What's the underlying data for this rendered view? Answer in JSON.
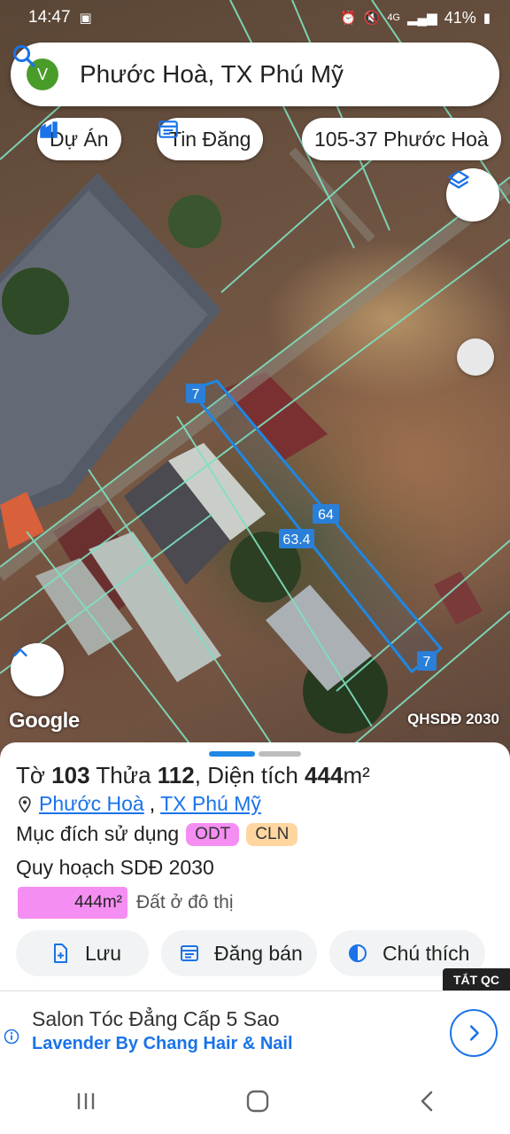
{
  "status_bar": {
    "time": "14:47",
    "battery": "41%",
    "network": "4G"
  },
  "search": {
    "avatar_letter": "V",
    "query": "Phước Hoà, TX Phú Mỹ"
  },
  "chips": [
    {
      "label": "Dự Án",
      "icon": "building-icon"
    },
    {
      "label": "Tin Đăng",
      "icon": "calendar-list-icon"
    },
    {
      "label": "105-37 Phước Hoà"
    }
  ],
  "map": {
    "parcel_labels": {
      "top": "7",
      "side_long": "64",
      "side_short": "63.4",
      "bottom": "7"
    },
    "google_logo": "Google",
    "plan_tag": "QHSDĐ 2030",
    "accent_color": "#1e88e5",
    "boundary_color": "#7fe0c0"
  },
  "sheet": {
    "to_label": "Tờ",
    "to_value": "103",
    "thua_label": "Thửa",
    "thua_value": "112",
    "area_label": "Diện tích",
    "area_value": "444",
    "area_unit": "m²",
    "location_ward": "Phước Hoà",
    "location_town": "TX Phú Mỹ",
    "purpose_label": "Mục đích sử dụng",
    "purpose_badges": [
      {
        "code": "ODT",
        "color": "#f58ef2"
      },
      {
        "code": "CLN",
        "color": "#ffd6a0"
      }
    ],
    "plan_title": "Quy hoạch SDĐ 2030",
    "plan_area": "444m²",
    "plan_area_desc": "Đất ở đô thị",
    "actions": [
      {
        "label": "Lưu",
        "icon": "save-plus-icon"
      },
      {
        "label": "Đăng bán",
        "icon": "calendar-list-icon"
      },
      {
        "label": "Chú thích",
        "icon": "half-circle-icon"
      }
    ]
  },
  "ad": {
    "close_label": "TẮT QC",
    "title": "Salon Tóc Đẳng Cấp 5 Sao",
    "subtitle": "Lavender By Chang Hair & Nail"
  }
}
